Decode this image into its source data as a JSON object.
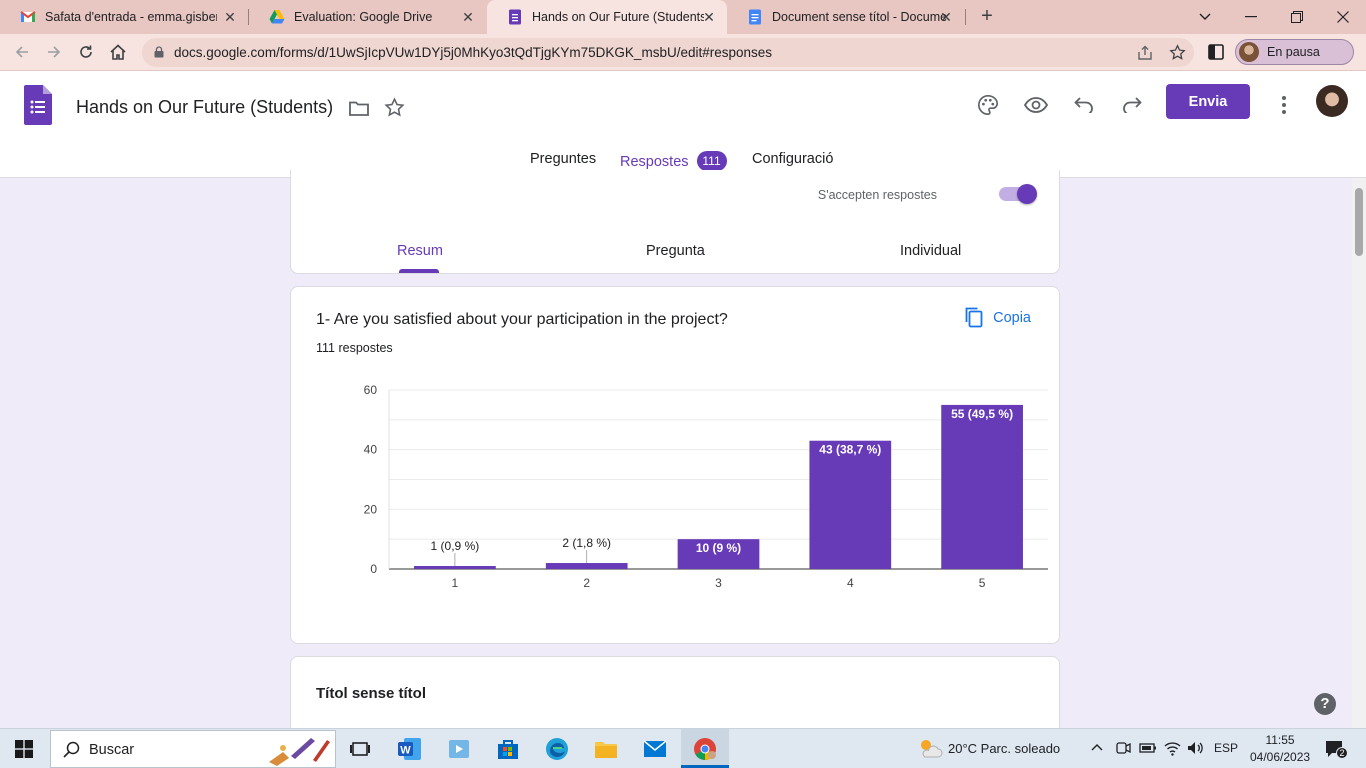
{
  "browser": {
    "tabs": [
      {
        "title": "Safata d'entrada - emma.gisbert@",
        "icon": "gmail-icon",
        "active": false
      },
      {
        "title": "Evaluation: Google Drive",
        "icon": "drive-icon",
        "active": false
      },
      {
        "title": "Hands on Our Future (Students) -",
        "icon": "forms-icon",
        "active": true
      },
      {
        "title": "Document sense títol - Documen",
        "icon": "docs-icon",
        "active": false
      }
    ],
    "url": "docs.google.com/forms/d/1UwSjIcpVUw1DYj5j0MhKyo3tQdTjgKYm75DKGK_msbU/edit#responses",
    "profile_label": "En pausa"
  },
  "form": {
    "title": "Hands on Our Future (Students)",
    "send_label": "Envia",
    "tabs": [
      "Preguntes",
      "Respostes",
      "Configuració"
    ],
    "responses_badge": "111",
    "accepting_label": "S'accepten respostes",
    "accepting_on": true,
    "view_tabs": [
      "Resum",
      "Pregunta",
      "Individual"
    ],
    "accent_color": "#673ab7"
  },
  "question": {
    "title": "1- Are you satisfied about your participation in the project?",
    "count_label": "111 respostes",
    "copy_label": "Copia"
  },
  "chart_data": {
    "type": "bar",
    "categories": [
      "1",
      "2",
      "3",
      "4",
      "5"
    ],
    "values": [
      1,
      2,
      10,
      43,
      55
    ],
    "labels": [
      "1 (0,9 %)",
      "2 (1,8 %)",
      "10 (9 %)",
      "43 (38,7 %)",
      "55 (49,5 %)"
    ],
    "yticks": [
      "0",
      "20",
      "40",
      "60"
    ],
    "ylim": [
      0,
      60
    ],
    "grid": true,
    "color": "#673ab7"
  },
  "next_card": {
    "title": "Títol sense títol"
  },
  "taskbar": {
    "search_label": "Buscar",
    "weather": "20°C  Parc. soleado",
    "lang": "ESP",
    "time": "11:55",
    "date": "04/06/2023",
    "notifications": "2"
  }
}
